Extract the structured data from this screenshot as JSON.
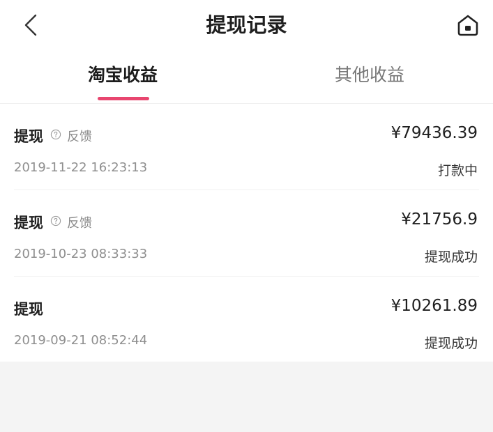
{
  "header": {
    "title": "提现记录",
    "back_icon": "chevron-left-icon",
    "home_icon": "home-icon"
  },
  "tabs": [
    {
      "label": "淘宝收益",
      "active": true
    },
    {
      "label": "其他收益",
      "active": false
    }
  ],
  "colors": {
    "accent": "#e8466f",
    "background": "#f4f4f4"
  },
  "records": [
    {
      "type": "提现",
      "feedback": "反馈",
      "amount": "¥79436.39",
      "datetime": "2019-11-22 16:23:13",
      "status": "打款中"
    },
    {
      "type": "提现",
      "feedback": "反馈",
      "amount": "¥21756.9",
      "datetime": "2019-10-23 08:33:33",
      "status": "提现成功"
    },
    {
      "type": "提现",
      "amount": "¥10261.89",
      "datetime": "2019-09-21 08:52:44",
      "status": "提现成功"
    }
  ]
}
